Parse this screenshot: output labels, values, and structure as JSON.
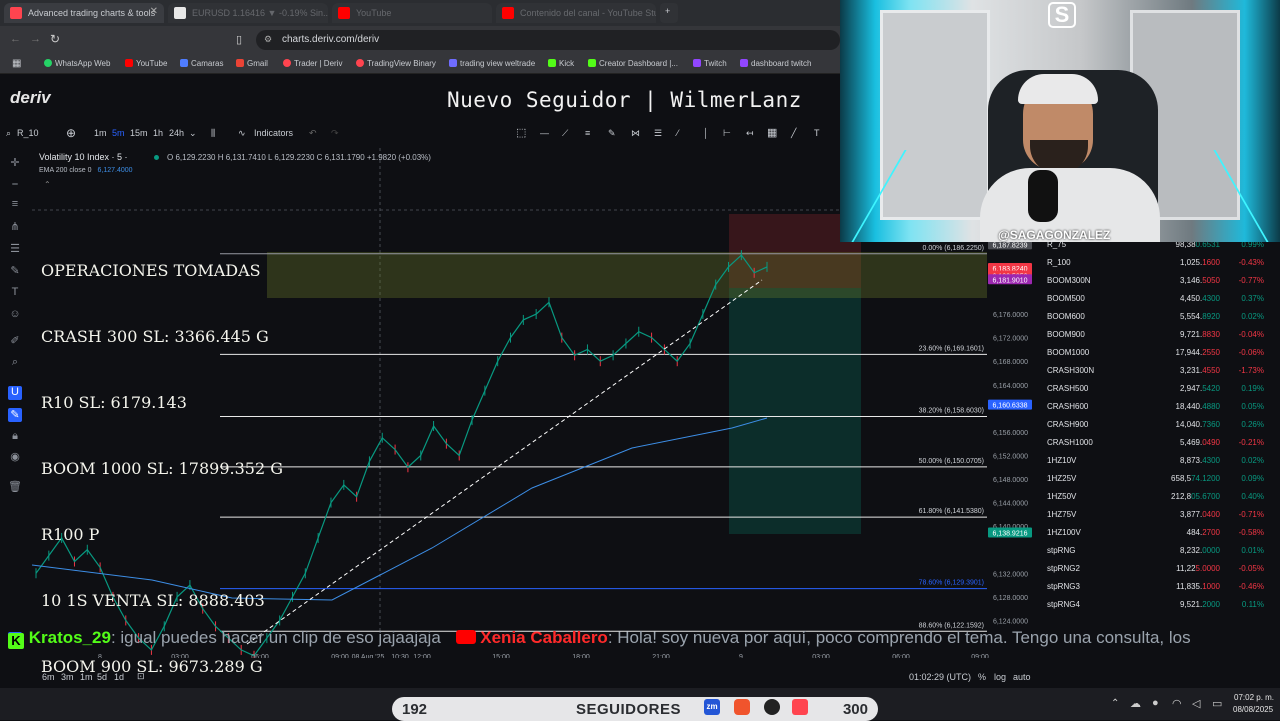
{
  "browser": {
    "tabs": [
      {
        "label": "Advanced trading charts & tools",
        "icon_color": "#ff444f"
      },
      {
        "label": "EURUSD 1.16416 ▼ -0.19% Sin...",
        "icon_color": "#ffffff"
      },
      {
        "label": "YouTube",
        "icon_color": "#ff0000"
      },
      {
        "label": "Contenido del canal - YouTube Studio",
        "icon_color": "#ff0000"
      }
    ],
    "new_tab_glyph": "+",
    "url": "charts.deriv.com/deriv",
    "bookmarks": [
      {
        "label": "WhatsApp Web",
        "color": "#25d366"
      },
      {
        "label": "YouTube",
        "color": "#ff0000"
      },
      {
        "label": "Camaras",
        "color": "#4f7dff"
      },
      {
        "label": "Gmail",
        "color": "#ea4335"
      },
      {
        "label": "Trader | Deriv",
        "color": "#ff444f"
      },
      {
        "label": "TradingView Binary",
        "color": "#ff444f"
      },
      {
        "label": "trading view weltrade",
        "color": "#6f6cff"
      },
      {
        "label": "Kick",
        "color": "#53fc18"
      },
      {
        "label": "Creator Dashboard |...",
        "color": "#53fc18"
      },
      {
        "label": "Twitch",
        "color": "#9146ff"
      },
      {
        "label": "dashboard twitch",
        "color": "#9146ff"
      }
    ]
  },
  "app": {
    "logo": "deriv",
    "stream_title": "Nuevo Seguidor | WilmerLanz"
  },
  "toolbar": {
    "symbol": "R_10",
    "intervals": [
      "1m",
      "5m",
      "15m",
      "1h",
      "24h"
    ],
    "active_interval": "5m",
    "indicators_label": "Indicators"
  },
  "legend": {
    "instrument": "Volatility 10 Index · 5 ·",
    "ohlc": "O 6,129.2230 H 6,131.7410 L 6,129.2230 C 6,131.1790 +1.9820 (+0.03%)",
    "ema": "EMA 200 close 0",
    "ema_value": "6,127.4000"
  },
  "operations": {
    "lines": [
      "OPERACIONES TOMADAS",
      "CRASH 300 SL: 3366.445 G",
      "R10 SL: 6179.143",
      "BOOM 1000 SL: 17899.352 G",
      "R100 P",
      "10 1S VENTA SL: 8888.403",
      "BOOM 900 SL: 9673.289 G"
    ]
  },
  "chart_data": {
    "type": "line",
    "title": "",
    "price_labels": [
      "6,192.0000",
      "6,176.0000",
      "6,172.0000",
      "6,168.0000",
      "6,164.0000",
      "6,156.0000",
      "6,152.0000",
      "6,148.0000",
      "6,144.0000",
      "6,140.0000",
      "6,132.0000",
      "6,128.0000",
      "6,124.0000"
    ],
    "price_tags": [
      {
        "text": "6,187.8239",
        "color": "#4a4c52"
      },
      {
        "text": "6,183.8240",
        "color": "#f23645"
      },
      {
        "text": "6,182.5350",
        "color": "#f23645"
      },
      {
        "text": "6,181.9010",
        "color": "#9c27b0"
      },
      {
        "text": "6,160.6338",
        "color": "#2962ff"
      },
      {
        "text": "6,138.9216",
        "color": "#089981"
      }
    ],
    "fib_levels": [
      {
        "label": "0.00% (6,186.2250)",
        "value": 6186.225
      },
      {
        "label": "23.60% (6,169.1601)",
        "value": 6169.1601
      },
      {
        "label": "38.20% (6,158.6030)",
        "value": 6158.603
      },
      {
        "label": "50.00% (6,150.0705)",
        "value": 6150.0705
      },
      {
        "label": "61.80% (6,141.5380)",
        "value": 6141.538
      },
      {
        "label": "78.60% (6,129.3901)",
        "value": 6129.3901
      },
      {
        "label": "88.60% (6,122.1592)",
        "value": 6122.1592
      }
    ],
    "time_labels": [
      "8",
      "03:00",
      "06:00",
      "09:00",
      "08 Aug '25",
      "10:30",
      "12:00",
      "15:00",
      "18:00",
      "21:00",
      "9",
      "03:00",
      "06:00",
      "09:00"
    ],
    "ylim": [
      6120,
      6194
    ],
    "series_close": [
      6132,
      6135,
      6138,
      6134,
      6136,
      6133,
      6128,
      6124,
      6121,
      6119,
      6123,
      6128,
      6130,
      6126,
      6123,
      6121,
      6119,
      6118,
      6121,
      6124,
      6128,
      6132,
      6138,
      6144,
      6147,
      6145,
      6151,
      6155,
      6153,
      6150,
      6152,
      6157,
      6154,
      6152,
      6158,
      6163,
      6168,
      6172,
      6175,
      6176,
      6178,
      6172,
      6169,
      6170,
      6168,
      6169,
      6171,
      6173,
      6172,
      6170,
      6168,
      6171,
      6176,
      6181,
      6184,
      6186,
      6183,
      6184
    ]
  },
  "watchlist": [
    {
      "symbol": "R_75",
      "price_a": "98,38",
      "price_b": "0.6531",
      "change": "0.99%",
      "up": true
    },
    {
      "symbol": "R_100",
      "price_a": "1,025.",
      "price_b": "1600",
      "change": "-0.43%",
      "up": false
    },
    {
      "symbol": "BOOM300N",
      "price_a": "3,146.",
      "price_b": "5050",
      "change": "-0.77%",
      "up": false
    },
    {
      "symbol": "BOOM500",
      "price_a": "4,450.",
      "price_b": "4300",
      "change": "0.37%",
      "up": true
    },
    {
      "symbol": "BOOM600",
      "price_a": "5,554.",
      "price_b": "8920",
      "change": "0.02%",
      "up": true
    },
    {
      "symbol": "BOOM900",
      "price_a": "9,721.",
      "price_b": "8830",
      "change": "-0.04%",
      "up": false
    },
    {
      "symbol": "BOOM1000",
      "price_a": "17,944.",
      "price_b": "2550",
      "change": "-0.06%",
      "up": false
    },
    {
      "symbol": "CRASH300N",
      "price_a": "3,231.",
      "price_b": "4550",
      "change": "-1.73%",
      "up": false
    },
    {
      "symbol": "CRASH500",
      "price_a": "2,947.",
      "price_b": "5420",
      "change": "0.19%",
      "up": true
    },
    {
      "symbol": "CRASH600",
      "price_a": "18,440.",
      "price_b": "4880",
      "change": "0.05%",
      "up": true
    },
    {
      "symbol": "CRASH900",
      "price_a": "14,040.",
      "price_b": "7360",
      "change": "0.26%",
      "up": true
    },
    {
      "symbol": "CRASH1000",
      "price_a": "5,469.",
      "price_b": "0490",
      "change": "-0.21%",
      "up": false
    },
    {
      "symbol": "1HZ10V",
      "price_a": "8,873.",
      "price_b": "4300",
      "change": "0.02%",
      "up": true
    },
    {
      "symbol": "1HZ25V",
      "price_a": "658,5",
      "price_b": "74.1200",
      "change": "0.09%",
      "up": true
    },
    {
      "symbol": "1HZ50V",
      "price_a": "212,8",
      "price_b": "05.6700",
      "change": "0.40%",
      "up": true
    },
    {
      "symbol": "1HZ75V",
      "price_a": "3,877.",
      "price_b": "0400",
      "change": "-0.71%",
      "up": false
    },
    {
      "symbol": "1HZ100V",
      "price_a": "484.",
      "price_b": "2700",
      "change": "-0.58%",
      "up": false
    },
    {
      "symbol": "stpRNG",
      "price_a": "8,232.",
      "price_b": "0000",
      "change": "0.01%",
      "up": true
    },
    {
      "symbol": "stpRNG2",
      "price_a": "11,22",
      "price_b": "5.0000",
      "change": "-0.05%",
      "up": false
    },
    {
      "symbol": "stpRNG3",
      "price_a": "11,835.",
      "price_b": "1000",
      "change": "-0.46%",
      "up": false
    },
    {
      "symbol": "stpRNG4",
      "price_a": "9,521.",
      "price_b": "2000",
      "change": "0.11%",
      "up": true
    }
  ],
  "webcam": {
    "logo": "S",
    "handle": "@SAGAGONZALEZ"
  },
  "chat": {
    "user1": "Kratos_29",
    "msg1": ": igual puedes hacer un clip de eso jajaajaja",
    "user2": "Xenia Caballero",
    "msg2": ": Hola! soy nueva por aquí, poco comprendo el tema. Tengo una consulta, los"
  },
  "bottom": {
    "ranges": [
      "6m",
      "3m",
      "1m",
      "5d",
      "1d"
    ],
    "clock": "01:02:29 (UTC)",
    "percent": "%",
    "log": "log",
    "auto": "auto"
  },
  "followers": {
    "count": "192",
    "label": "SEGUIDORES",
    "goal": "300"
  },
  "system": {
    "time": "07:02 p. m.",
    "date": "08/08/2025"
  },
  "colors": {
    "up": "#089981",
    "down": "#f23645",
    "accent": "#ff444f"
  }
}
